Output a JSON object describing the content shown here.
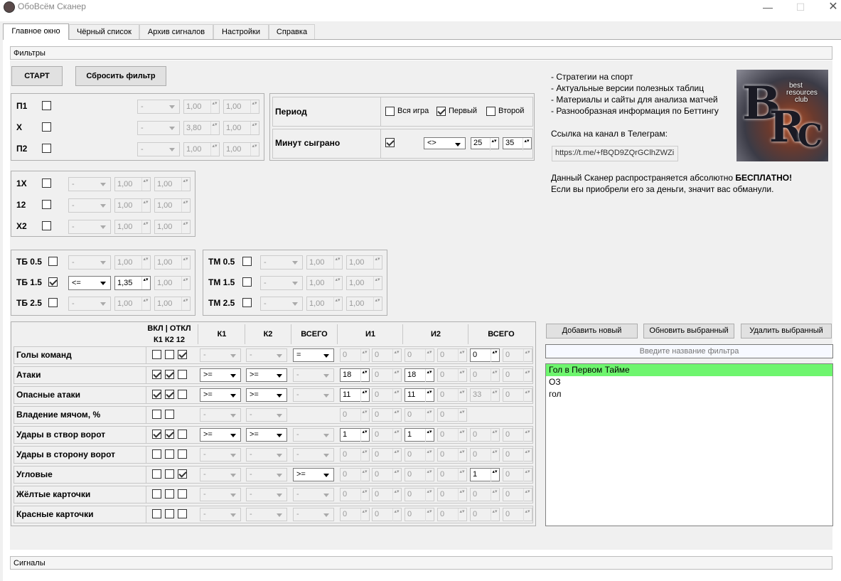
{
  "window": {
    "title": "ОбоВсём Сканер"
  },
  "tabs": [
    {
      "label": "Главное окно"
    },
    {
      "label": "Чёрный список"
    },
    {
      "label": "Архив сигналов"
    },
    {
      "label": "Настройки"
    },
    {
      "label": "Справка"
    }
  ],
  "panels": {
    "filters": "Фильтры",
    "signals": "Сигналы"
  },
  "buttons": {
    "start": "СТАРТ",
    "reset": "Сбросить фильтр",
    "add": "Добавить новый",
    "update": "Обновить выбранный",
    "delete": "Удалить выбранный"
  },
  "outcomes": [
    {
      "label": "П1",
      "checked": false,
      "op": "-",
      "v1": "1,00",
      "v2": "1,00"
    },
    {
      "label": "X",
      "checked": false,
      "op": "-",
      "v1": "3,80",
      "v2": "1,00"
    },
    {
      "label": "П2",
      "checked": false,
      "op": "-",
      "v1": "1,00",
      "v2": "1,00"
    }
  ],
  "doubles": [
    {
      "label": "1X",
      "checked": false,
      "op": "-",
      "v1": "1,00",
      "v2": "1,00"
    },
    {
      "label": "12",
      "checked": false,
      "op": "-",
      "v1": "1,00",
      "v2": "1,00"
    },
    {
      "label": "X2",
      "checked": false,
      "op": "-",
      "v1": "1,00",
      "v2": "1,00"
    }
  ],
  "totals_over": [
    {
      "label": "ТБ 0.5",
      "checked": false,
      "op": "-",
      "v1": "1,00",
      "v2": "1,00"
    },
    {
      "label": "ТБ 1.5",
      "checked": true,
      "op": "<=",
      "v1": "1,35",
      "v2": "1,00"
    },
    {
      "label": "ТБ 2.5",
      "checked": false,
      "op": "-",
      "v1": "1,00",
      "v2": "1,00"
    }
  ],
  "totals_under": [
    {
      "label": "ТМ 0.5",
      "checked": false,
      "op": "-",
      "v1": "1,00",
      "v2": "1,00"
    },
    {
      "label": "ТМ 1.5",
      "checked": false,
      "op": "-",
      "v1": "1,00",
      "v2": "1,00"
    },
    {
      "label": "ТМ 2.5",
      "checked": false,
      "op": "-",
      "v1": "1,00",
      "v2": "1,00"
    }
  ],
  "period": {
    "label": "Период",
    "options": [
      {
        "label": "Вся игра",
        "checked": false
      },
      {
        "label": "Первый",
        "checked": true
      },
      {
        "label": "Второй",
        "checked": false
      }
    ]
  },
  "minutes": {
    "label": "Минут сыграно",
    "checked": true,
    "op": "<>",
    "from": "25",
    "to": "35"
  },
  "stats_headers": {
    "vkl": "ВКЛ | ОТКЛ",
    "k1k2": "К1 К2 12",
    "k1": "К1",
    "k2": "К2",
    "total1": "ВСЕГО",
    "i1": "И1",
    "i2": "И2",
    "total2": "ВСЕГО"
  },
  "stats": [
    {
      "label": "Голы команд",
      "c": [
        false,
        false,
        true
      ],
      "k1": "-",
      "k2": "-",
      "tot": "=",
      "totEn": true,
      "v": [
        "0",
        "0",
        "0",
        "0",
        "0",
        "0"
      ],
      "en": [
        false,
        false,
        false,
        false,
        true,
        false
      ]
    },
    {
      "label": "Атаки",
      "c": [
        true,
        true,
        false
      ],
      "k1": ">=",
      "k2": ">=",
      "k1En": true,
      "k2En": true,
      "tot": "-",
      "v": [
        "18",
        "0",
        "18",
        "0",
        "0",
        "0"
      ],
      "en": [
        true,
        false,
        true,
        false,
        false,
        false
      ]
    },
    {
      "label": "Опасные атаки",
      "c": [
        true,
        true,
        false
      ],
      "k1": ">=",
      "k2": ">=",
      "k1En": true,
      "k2En": true,
      "tot": "-",
      "v": [
        "11",
        "0",
        "11",
        "0",
        "33",
        "0"
      ],
      "en": [
        true,
        false,
        true,
        false,
        false,
        false
      ]
    },
    {
      "label": "Владение мячом, %",
      "c": [
        false,
        false
      ],
      "k1": "-",
      "k2": "-",
      "noTot": true,
      "v": [
        "0",
        "0",
        "0",
        "0"
      ],
      "en": [
        false,
        false,
        false,
        false
      ]
    },
    {
      "label": "Удары в створ ворот",
      "c": [
        true,
        true,
        false
      ],
      "k1": ">=",
      "k2": ">=",
      "k1En": true,
      "k2En": true,
      "tot": "-",
      "v": [
        "1",
        "0",
        "1",
        "0",
        "0",
        "0"
      ],
      "en": [
        true,
        false,
        true,
        false,
        false,
        false
      ]
    },
    {
      "label": "Удары в сторону ворот",
      "c": [
        false,
        false,
        false
      ],
      "k1": "-",
      "k2": "-",
      "tot": "-",
      "v": [
        "0",
        "0",
        "0",
        "0",
        "0",
        "0"
      ],
      "en": [
        false,
        false,
        false,
        false,
        false,
        false
      ]
    },
    {
      "label": "Угловые",
      "c": [
        false,
        false,
        true
      ],
      "k1": "-",
      "k2": "-",
      "tot": ">=",
      "totEn": true,
      "v": [
        "0",
        "0",
        "0",
        "0",
        "1",
        "0"
      ],
      "en": [
        false,
        false,
        false,
        false,
        true,
        false
      ]
    },
    {
      "label": "Жёлтые карточки",
      "c": [
        false,
        false,
        false
      ],
      "k1": "-",
      "k2": "-",
      "tot": "-",
      "v": [
        "0",
        "0",
        "0",
        "0",
        "0",
        "0"
      ],
      "en": [
        false,
        false,
        false,
        false,
        false,
        false
      ]
    },
    {
      "label": "Красные карточки",
      "c": [
        false,
        false,
        false
      ],
      "k1": "-",
      "k2": "-",
      "tot": "-",
      "v": [
        "0",
        "0",
        "0",
        "0",
        "0",
        "0"
      ],
      "en": [
        false,
        false,
        false,
        false,
        false,
        false
      ]
    }
  ],
  "info": {
    "lines": [
      "- Стратегии на спорт",
      "- Актуальные версии полезных таблиц",
      "- Материалы и сайты для анализа матчей",
      "- Разнообразная информация по Беттингу"
    ],
    "telegram_label": "Ссылка на канал в Телеграм:",
    "telegram_link": "https://t.me/+fBQD9ZQrGClhZWZi",
    "free_prefix": "Данный Сканер распространяется абсолютно ",
    "free_bold": "БЕСПЛАТНО!",
    "scam": "Если вы приобрели его за деньги, значит вас обманули."
  },
  "logo": {
    "letters": [
      "B",
      "R",
      "C"
    ],
    "words": [
      "best",
      "resources",
      "club"
    ]
  },
  "filter_name_placeholder": "Введите название фильтра",
  "filters_list": [
    {
      "name": "Гол в Первом Тайме",
      "selected": true
    },
    {
      "name": "ОЗ",
      "selected": false
    },
    {
      "name": "гол",
      "selected": false
    }
  ]
}
